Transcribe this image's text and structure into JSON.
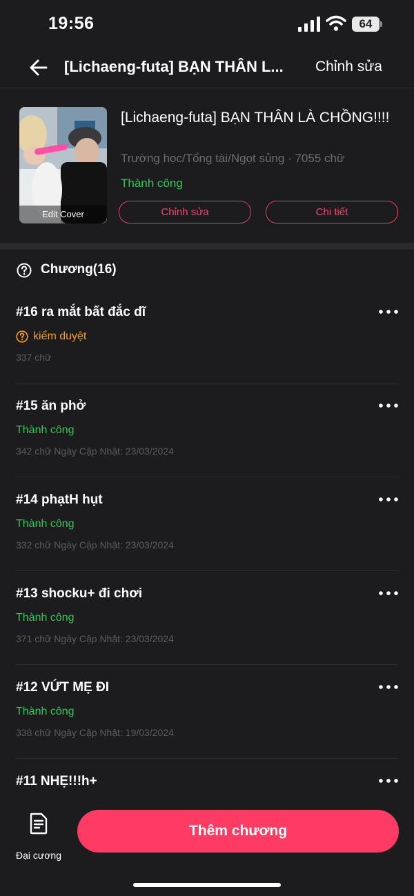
{
  "status": {
    "time": "19:56",
    "battery": "64"
  },
  "nav": {
    "title": "[Lichaeng-futa] BẠN THÂN L...",
    "edit_label": "Chỉnh sửa"
  },
  "book": {
    "cover_label": "Edit Cover",
    "title": "[Lichaeng-futa] BẠN THÂN LÀ CHỒNG!!!!",
    "meta": "Trường học/Tổng tài/Ngọt sủng · 7055 chữ",
    "status": "Thành công",
    "edit_button": "Chỉnh sửa",
    "detail_button": "Chi tiết"
  },
  "chapters_header": "Chương(16)",
  "chapters": [
    {
      "title": "#16 ra mắt bất đắc dĩ",
      "status": "kiểm duyệt",
      "meta": "337 chữ"
    },
    {
      "title": "#15 ăn phở",
      "status": "Thành công",
      "meta": "342 chữ Ngày Cập Nhật: 23/03/2024"
    },
    {
      "title": "#14 phạtH hụt",
      "status": "Thành công",
      "meta": "332 chữ Ngày Cập Nhật: 23/03/2024"
    },
    {
      "title": "#13 shocku+ đi chơi",
      "status": "Thành công",
      "meta": "371 chữ Ngày Cập Nhật: 23/03/2024"
    },
    {
      "title": "#12 VỨT MẸ ĐI",
      "status": "Thành công",
      "meta": "338 chữ Ngày Cập Nhật: 19/03/2024"
    },
    {
      "title": "#11 NHẸ!!!h+"
    }
  ],
  "bottom": {
    "outline_label": "Đại cương",
    "add_button": "Thêm chương"
  },
  "colors": {
    "accent": "#fe3b63",
    "success": "#34c759",
    "pending": "#ff9f0a",
    "background": "#1c1c1e"
  }
}
